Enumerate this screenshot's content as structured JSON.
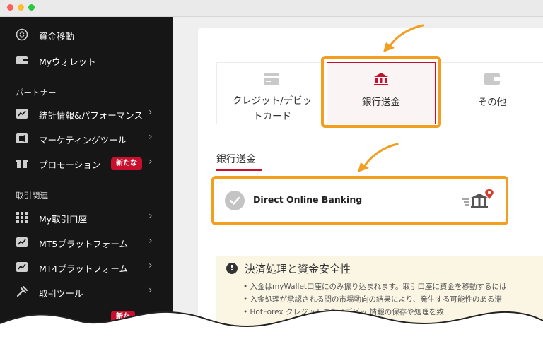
{
  "sidebar": {
    "items_top": [
      {
        "label": "資金移動",
        "icon": "transfer-icon"
      },
      {
        "label": "Myウォレット",
        "icon": "wallet-icon"
      }
    ],
    "section_partner": "パートナー",
    "partner_items": [
      {
        "label": "統計情報&パフォーマンス",
        "icon": "chart-icon"
      },
      {
        "label": "マーケティングツール",
        "icon": "marketing-icon"
      },
      {
        "label": "プロモーション",
        "icon": "gift-icon",
        "badge": "新たな"
      }
    ],
    "section_trade": "取引関連",
    "trade_items": [
      {
        "label": "My取引口座",
        "icon": "grid-icon"
      },
      {
        "label": "MT5プラットフォーム",
        "icon": "mt5-icon"
      },
      {
        "label": "MT4プラットフォーム",
        "icon": "mt4-icon"
      },
      {
        "label": "取引ツール",
        "icon": "tools-icon"
      }
    ],
    "partial_badge": "新た"
  },
  "methods": {
    "credit": "クレジット/デビット\nカード",
    "credit_line1": "クレジット/デビッ",
    "credit_line2": "トカード",
    "bank": "銀行送金",
    "other": "その他"
  },
  "tab": {
    "label": "銀行送金"
  },
  "bank_option": {
    "name": "Direct Online Banking",
    "icon": "bank-pin-icon"
  },
  "notice": {
    "title": "決済処理と資金安全性",
    "lines": [
      "• 入金はmyWallet口座にのみ振り込まれます。取引口座に資金を移動するには",
      "• 入金処理が承認される間の市場動向の結果により、発生する可能性のある滞",
      "• HotForex             クレジットまたはデビッ    情報の保存や処理を致"
    ]
  },
  "colors": {
    "accent": "#f29e1f",
    "brand_red": "#c8102e",
    "sidebar_bg": "#161616"
  }
}
